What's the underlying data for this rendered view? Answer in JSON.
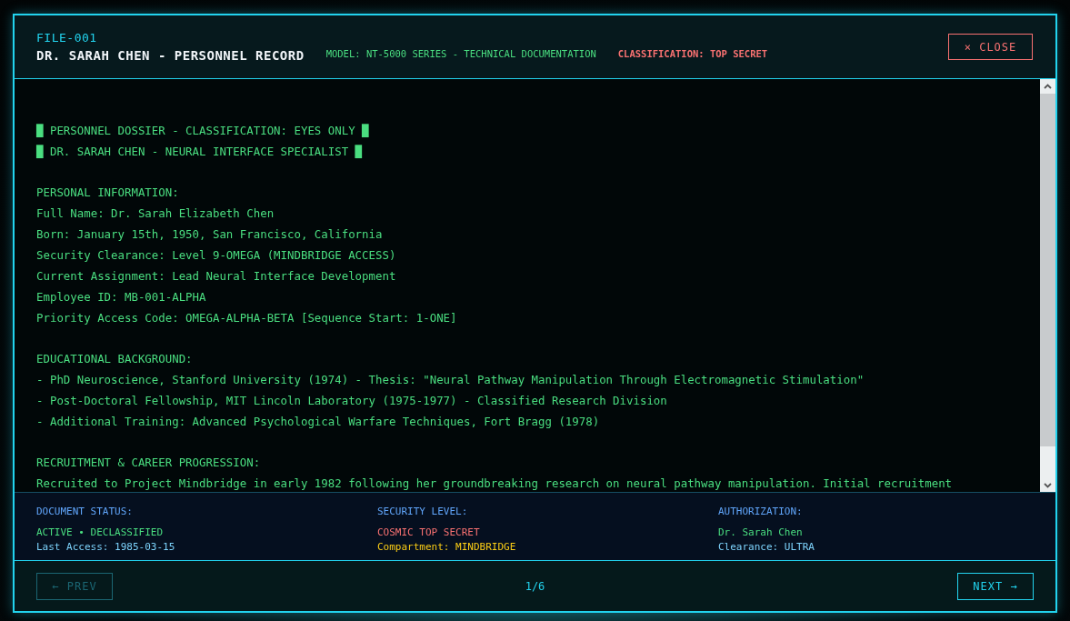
{
  "header": {
    "file_id": "FILE-001",
    "title": "DR. SARAH CHEN - PERSONNEL RECORD",
    "model": "MODEL: NT-5000 SERIES - TECHNICAL DOCUMENTATION",
    "classification": "CLASSIFICATION: TOP SECRET",
    "close_button": "× CLOSE"
  },
  "document": {
    "banners": [
      "█ PERSONNEL DOSSIER - CLASSIFICATION: EYES ONLY █",
      "█ DR. SARAH CHEN - NEURAL INTERFACE SPECIALIST █"
    ],
    "sections": [
      {
        "heading": "PERSONAL INFORMATION:",
        "lines": [
          "Full Name: Dr. Sarah Elizabeth Chen",
          "Born: January 15th, 1950, San Francisco, California",
          "Security Clearance: Level 9-OMEGA (MINDBRIDGE ACCESS)",
          "Current Assignment: Lead Neural Interface Development",
          "Employee ID: MB-001-ALPHA",
          "Priority Access Code: OMEGA-ALPHA-BETA [Sequence Start: 1-ONE]"
        ]
      },
      {
        "heading": "EDUCATIONAL BACKGROUND:",
        "lines": [
          "- PhD Neuroscience, Stanford University (1974) - Thesis: \"Neural Pathway Manipulation Through Electromagnetic Stimulation\"",
          "- Post-Doctoral Fellowship, MIT Lincoln Laboratory (1975-1977) - Classified Research Division",
          "- Additional Training: Advanced Psychological Warfare Techniques, Fort Bragg (1978)"
        ]
      },
      {
        "heading": "RECRUITMENT & CAREER PROGRESSION:",
        "lines": [
          "Recruited to Project Mindbridge in early 1982 following her groundbreaking research on neural pathway manipulation. Initial recruitment"
        ]
      }
    ]
  },
  "status": [
    {
      "label": "DOCUMENT STATUS:",
      "lines": [
        {
          "text": "ACTIVE • DECLASSIFIED",
          "color": "#4ade80"
        },
        {
          "text": "Last Access: 1985-03-15",
          "color": "#7dd3fc"
        }
      ]
    },
    {
      "label": "SECURITY LEVEL:",
      "lines": [
        {
          "text": "COSMIC TOP SECRET",
          "color": "#f87171"
        },
        {
          "text": "Compartment: MINDBRIDGE",
          "color": "#facc15"
        }
      ]
    },
    {
      "label": "AUTHORIZATION:",
      "lines": [
        {
          "text": "Dr. Sarah Chen",
          "color": "#4ade80"
        },
        {
          "text": "Clearance: ULTRA",
          "color": "#7dd3fc"
        }
      ]
    }
  ],
  "footer": {
    "prev_button": {
      "label": "← PREV",
      "disabled": true
    },
    "page": "1/6",
    "next_button": {
      "label": "NEXT →",
      "disabled": false
    }
  }
}
